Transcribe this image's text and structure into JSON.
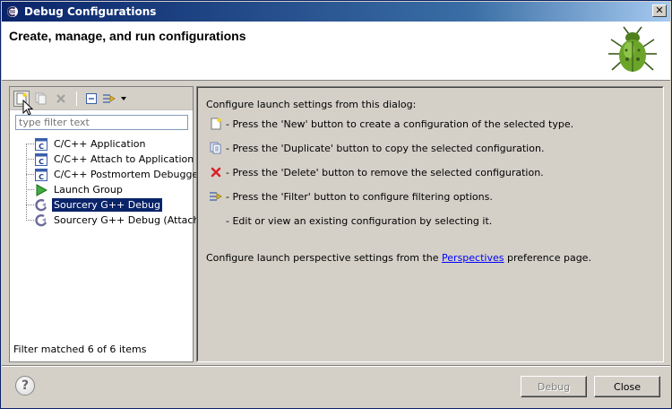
{
  "window": {
    "title": "Debug Configurations"
  },
  "banner": {
    "title": "Create, manage, and run configurations"
  },
  "toolbar": {
    "buttons": [
      "new-config-icon",
      "duplicate-icon",
      "delete-icon",
      "collapse-all-icon",
      "filter-icon",
      "dropdown-arrow-icon"
    ]
  },
  "filter": {
    "placeholder": "type filter text",
    "value": ""
  },
  "tree": {
    "items": [
      {
        "label": "C/C++ Application",
        "icon": "c-app-icon",
        "selected": false
      },
      {
        "label": "C/C++ Attach to Application",
        "icon": "c-app-icon",
        "selected": false
      },
      {
        "label": "C/C++ Postmortem Debugger",
        "icon": "c-app-icon",
        "selected": false
      },
      {
        "label": "Launch Group",
        "icon": "launch-group-icon",
        "selected": false
      },
      {
        "label": "Sourcery G++ Debug",
        "icon": "sourcery-icon",
        "selected": true
      },
      {
        "label": "Sourcery G++ Debug (Attach)",
        "icon": "sourcery-icon",
        "selected": false
      }
    ],
    "status": "Filter matched 6 of 6 items"
  },
  "help": {
    "intro": "Configure launch settings from this dialog:",
    "lines": [
      {
        "icon": "new-config-icon",
        "text": "- Press the 'New' button to create a configuration of the selected type."
      },
      {
        "icon": "duplicate-icon",
        "text": "- Press the 'Duplicate' button to copy the selected configuration."
      },
      {
        "icon": "delete-icon",
        "text": "- Press the 'Delete' button to remove the selected configuration."
      },
      {
        "icon": "filter-icon",
        "text": "- Press the 'Filter' button to configure filtering options."
      },
      {
        "icon": "",
        "text": "- Edit or view an existing configuration by selecting it."
      }
    ],
    "perspective_before": "Configure launch perspective settings from the ",
    "perspective_link": "Perspectives",
    "perspective_after": " preference page."
  },
  "buttons": {
    "debug": "Debug",
    "close": "Close",
    "help": "?"
  },
  "colors": {
    "selection": "#0a246a",
    "dialog_bg": "#d4d0c8",
    "link": "#0000ff"
  }
}
